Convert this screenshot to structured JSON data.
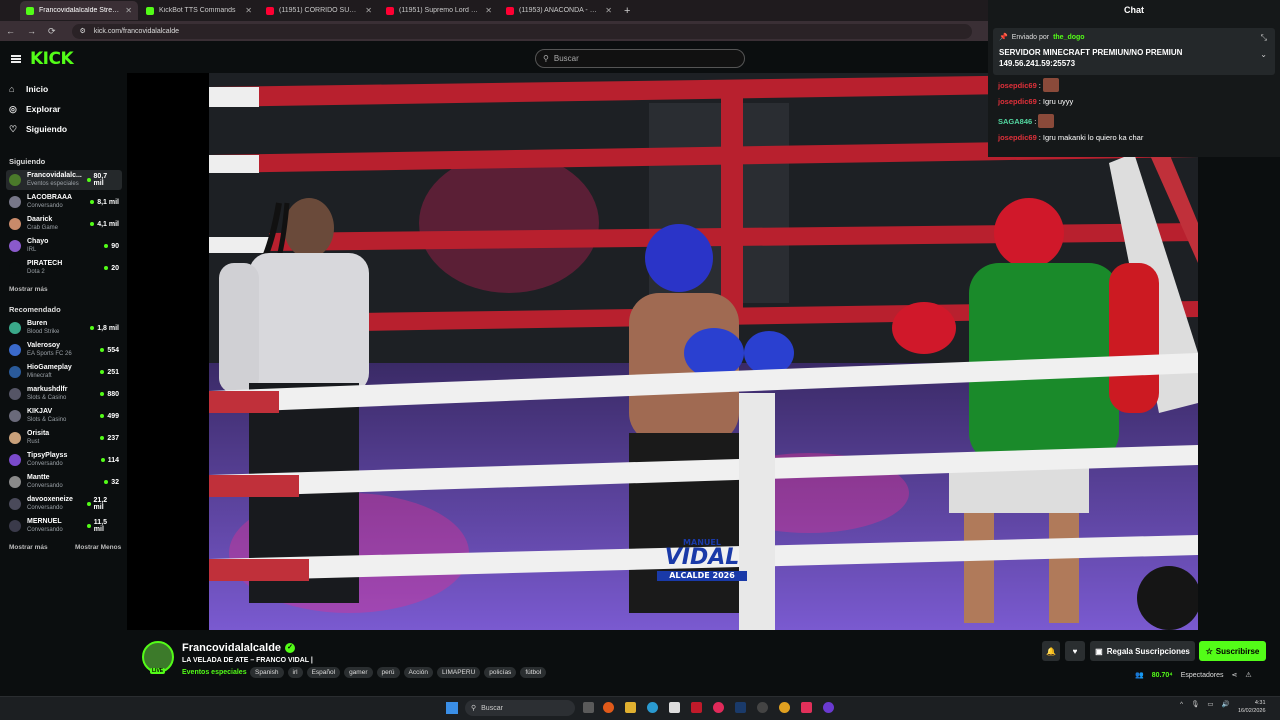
{
  "browser": {
    "tabs": [
      {
        "label": "Francovidalalcalde Stream",
        "active": true,
        "favicon_color": "#53fc18"
      },
      {
        "label": "KickBot TTS Commands",
        "active": false,
        "favicon_color": "#53fc18"
      },
      {
        "label": "(11951) CORRIDO SUPREMO -",
        "active": false,
        "favicon_color": "#ff0033"
      },
      {
        "label": "(11951) Supremo Lord Oficial",
        "active": false,
        "favicon_color": "#ff0033"
      },
      {
        "label": "(11953) ANACONDA - SUPREM",
        "active": false,
        "favicon_color": "#ff0033"
      }
    ],
    "url": "kick.com/francovidalalcalde"
  },
  "header": {
    "logo": "KICK",
    "search_placeholder": "Buscar"
  },
  "sidebar": {
    "nav": [
      {
        "label": "Inicio",
        "icon": "home-icon"
      },
      {
        "label": "Explorar",
        "icon": "compass-icon"
      },
      {
        "label": "Siguiendo",
        "icon": "heart-icon"
      }
    ],
    "following_title": "Siguiendo",
    "following": [
      {
        "name": "Francovidalalc...",
        "category": "Eventos especiales",
        "viewers": "80,7 mil",
        "avatar_color": "#4a7a2a"
      },
      {
        "name": "LACOBRAAA",
        "category": "Conversando",
        "viewers": "8,1 mil",
        "avatar_color": "#777788"
      },
      {
        "name": "Daarick",
        "category": "Crab Game",
        "viewers": "4,1 mil",
        "avatar_color": "#c98a6a"
      },
      {
        "name": "Chayo",
        "category": "IRL",
        "viewers": "90",
        "avatar_color": "#8a5acb"
      },
      {
        "name": "PIRATECH",
        "category": "Dota 2",
        "viewers": "20",
        "avatar_color": "#0b0e0f"
      }
    ],
    "show_more_following": "Mostrar más",
    "recommended_title": "Recomendado",
    "recommended": [
      {
        "name": "Buren",
        "category": "Blood Strike",
        "viewers": "1,8 mil",
        "avatar_color": "#3aa88a"
      },
      {
        "name": "Valerosoy",
        "category": "EA Sports FC 26",
        "viewers": "554",
        "avatar_color": "#3a6acb"
      },
      {
        "name": "HioGameplay",
        "category": "Minecraft",
        "viewers": "251",
        "avatar_color": "#2a5a9a"
      },
      {
        "name": "markushdlfr",
        "category": "Slots & Casino",
        "viewers": "880",
        "avatar_color": "#555566"
      },
      {
        "name": "KIKJAV",
        "category": "Slots & Casino",
        "viewers": "499",
        "avatar_color": "#6a6a7a"
      },
      {
        "name": "Orisita",
        "category": "Rust",
        "viewers": "237",
        "avatar_color": "#c9a07a"
      },
      {
        "name": "TipsyPlayss",
        "category": "Conversando",
        "viewers": "114",
        "avatar_color": "#7a4acb"
      },
      {
        "name": "Mantte",
        "category": "Conversando",
        "viewers": "32",
        "avatar_color": "#8a8a8a"
      },
      {
        "name": "davooxeneize",
        "category": "Conversando",
        "viewers": "21,2 mil",
        "avatar_color": "#4a4a5a"
      },
      {
        "name": "MERNUEL",
        "category": "Conversando",
        "viewers": "11,5 mil",
        "avatar_color": "#3a3a4a"
      }
    ],
    "show_more": "Mostrar más",
    "show_less": "Mostrar Menos"
  },
  "chat": {
    "title": "Chat",
    "pinned_prefix": "Enviado por",
    "pinned_user": "the_dogo",
    "pinned_line1": "SERVIDOR MINECRAFT PREMIUN/NO PREMIUN",
    "pinned_line2": "149.56.241.59:25573",
    "messages": [
      {
        "user": "josepdic69",
        "text": "",
        "emote": true,
        "color": "#e0303a"
      },
      {
        "user": "josepdic69",
        "text": "Igru uyyy",
        "emote": false,
        "color": "#e0303a"
      },
      {
        "user": "SAGA846",
        "text": "",
        "emote": true,
        "color": "#53d6a0"
      },
      {
        "user": "josepdic69",
        "text": "Igru makanki lo quiero ka char",
        "emote": false,
        "color": "#e0303a"
      }
    ]
  },
  "video": {
    "overlay_line1": "MANUEL",
    "overlay_line2": "VIDAL",
    "overlay_line3": "ALCALDE 2026"
  },
  "stream": {
    "channel": "Francovidalalcalde",
    "live_badge": "LIVE",
    "title": "LA VELADA DE ATE – FRANCO VIDAL |",
    "category": "Eventos especiales",
    "tags": [
      "Spanish",
      "irl",
      "Español",
      "gamer",
      "perú",
      "Acción",
      "LIMAPERU",
      "policías",
      "fútbol"
    ],
    "gift_label": "Regala Suscripciones",
    "subscribe_label": "Suscribirse",
    "viewers": "80.70⁴",
    "viewers_label": "Espectadores"
  },
  "taskbar": {
    "search_label": "Buscar",
    "time": "4:31",
    "date": "16/02/2026"
  }
}
